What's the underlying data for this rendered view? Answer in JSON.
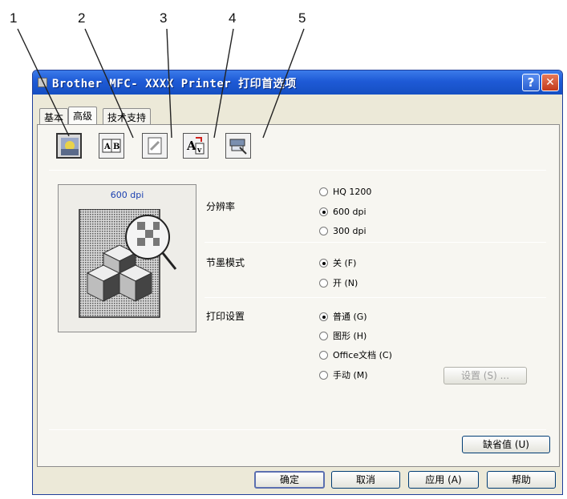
{
  "callouts": [
    "1",
    "2",
    "3",
    "4",
    "5"
  ],
  "window": {
    "title": "Brother MFC- XXXX  Printer 打印首选项",
    "help_glyph": "?",
    "close_glyph": "✕"
  },
  "tabs": [
    {
      "label": "基本",
      "active": false
    },
    {
      "label": "高级",
      "active": true
    },
    {
      "label": "技术支持",
      "active": false
    }
  ],
  "feature_icons": [
    {
      "name": "print-quality-icon"
    },
    {
      "name": "duplex-icon"
    },
    {
      "name": "watermark-icon"
    },
    {
      "name": "page-setting-icon"
    },
    {
      "name": "device-options-icon"
    }
  ],
  "preview": {
    "label": "600 dpi"
  },
  "resolution": {
    "label": "分辨率",
    "options": [
      {
        "label": "HQ 1200",
        "checked": false
      },
      {
        "label": "600 dpi",
        "checked": true
      },
      {
        "label": "300 dpi",
        "checked": false
      }
    ]
  },
  "toner_save": {
    "label": "节墨模式",
    "options": [
      {
        "label": "关 (F)",
        "checked": true
      },
      {
        "label": "开 (N)",
        "checked": false
      }
    ]
  },
  "print_setting": {
    "label": "打印设置",
    "options": [
      {
        "label": "普通 (G)",
        "checked": true
      },
      {
        "label": "图形 (H)",
        "checked": false
      },
      {
        "label": "Office文档 (C)",
        "checked": false
      },
      {
        "label": "手动 (M)",
        "checked": false
      }
    ],
    "settings_button": "设置 (S) ..."
  },
  "default_button": "缺省值 (U)",
  "footer": {
    "ok": "确定",
    "cancel": "取消",
    "apply": "应用 (A)",
    "help": "帮助"
  }
}
